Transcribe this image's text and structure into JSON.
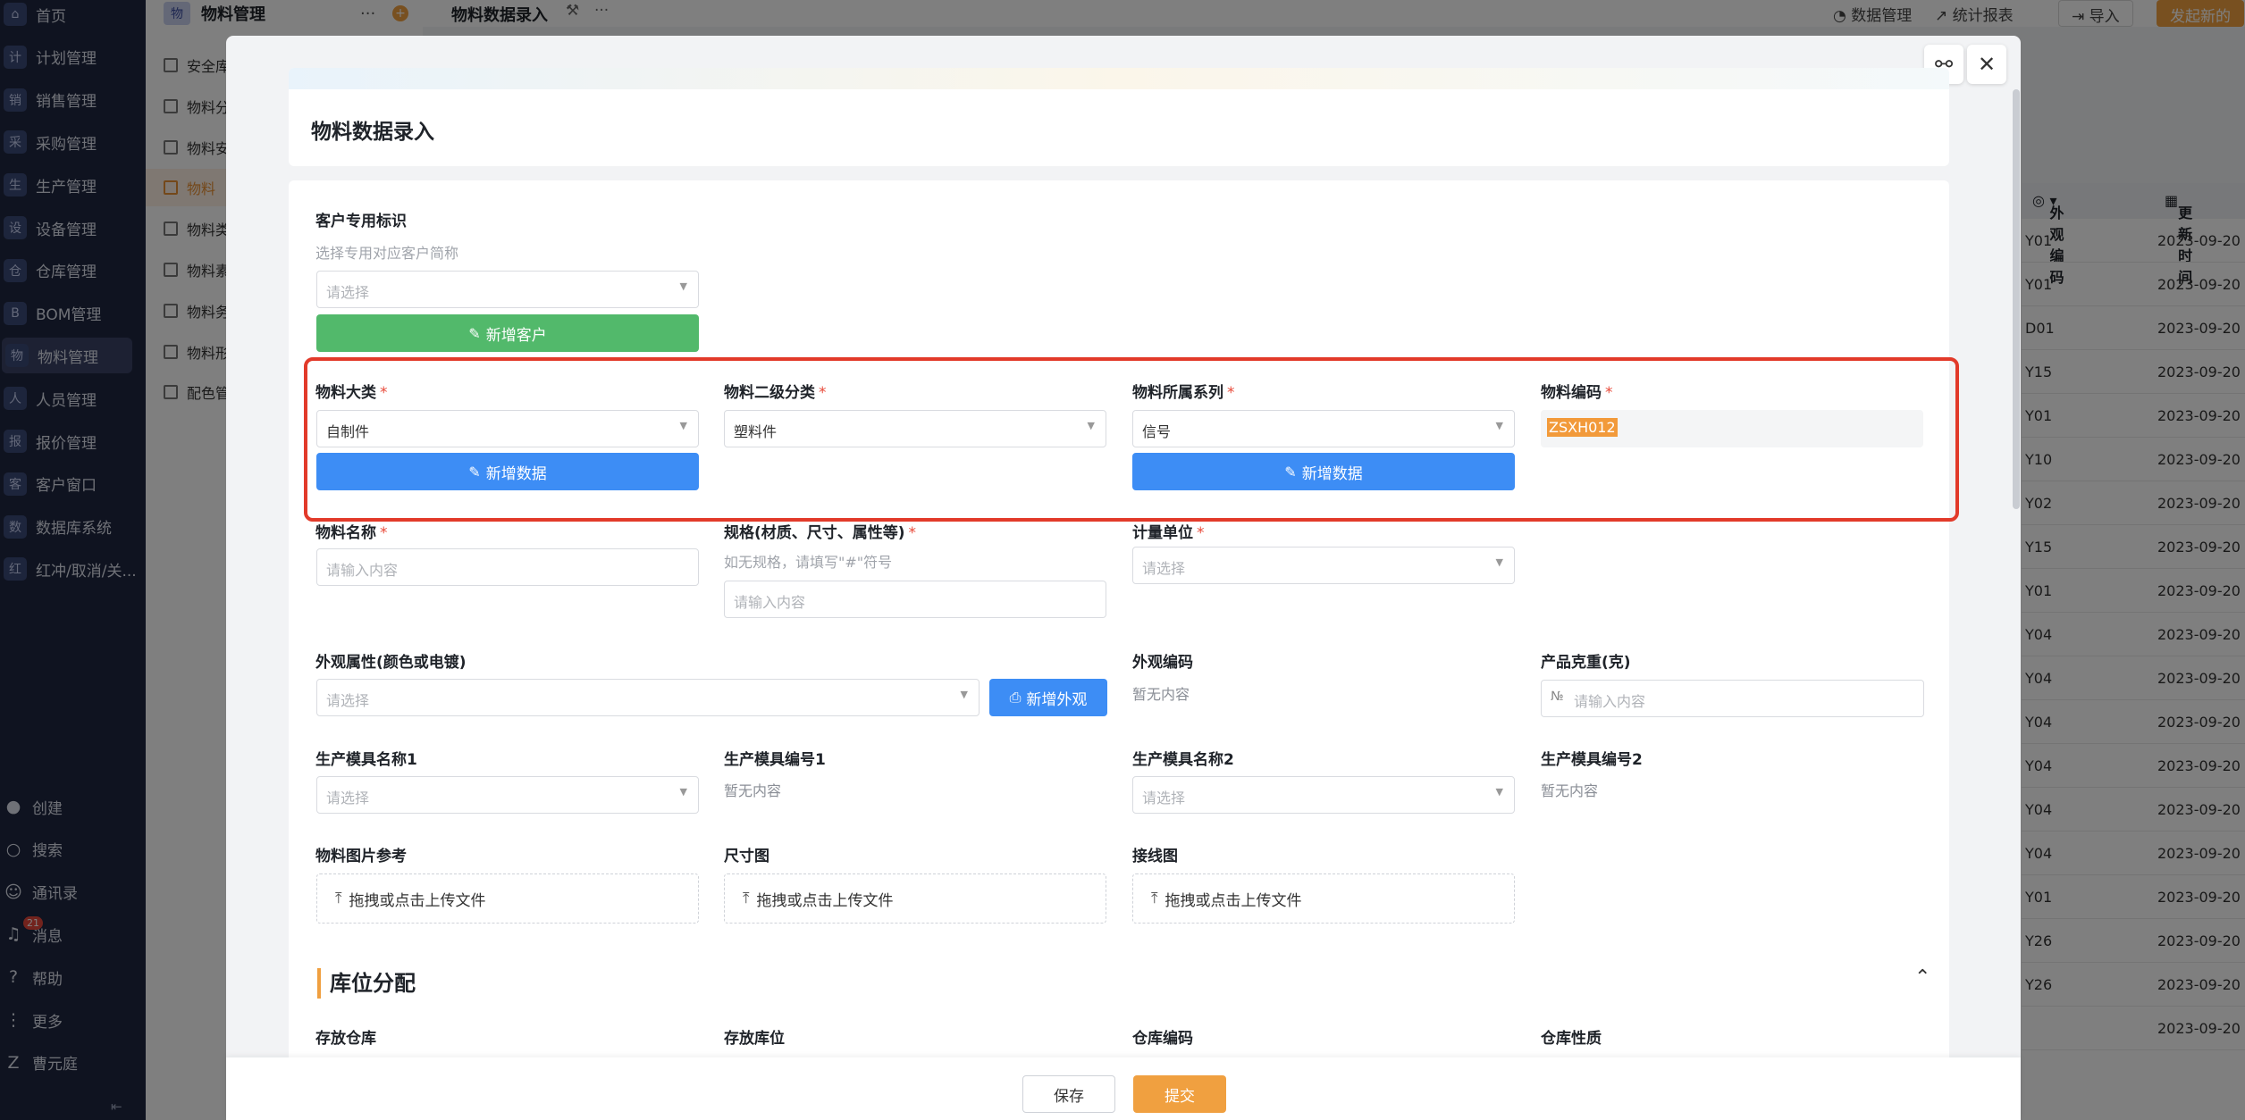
{
  "nav": {
    "items": [
      {
        "glyph": "⌂",
        "label": "首页"
      },
      {
        "glyph": "计",
        "label": "计划管理"
      },
      {
        "glyph": "销",
        "label": "销售管理"
      },
      {
        "glyph": "采",
        "label": "采购管理"
      },
      {
        "glyph": "生",
        "label": "生产管理"
      },
      {
        "glyph": "设",
        "label": "设备管理"
      },
      {
        "glyph": "仓",
        "label": "仓库管理"
      },
      {
        "glyph": "B",
        "label": "BOM管理"
      },
      {
        "glyph": "物",
        "label": "物料管理"
      },
      {
        "glyph": "人",
        "label": "人员管理"
      },
      {
        "glyph": "报",
        "label": "报价管理"
      },
      {
        "glyph": "客",
        "label": "客户窗口"
      },
      {
        "glyph": "数",
        "label": "数据库系统"
      },
      {
        "glyph": "红",
        "label": "红冲/取消/关..."
      }
    ],
    "bottom": [
      {
        "glyph": "●",
        "label": "创建"
      },
      {
        "glyph": "○",
        "label": "搜索"
      },
      {
        "glyph": "☺",
        "label": "通讯录"
      },
      {
        "glyph": "♫",
        "label": "消息"
      },
      {
        "glyph": "?",
        "label": "帮助"
      },
      {
        "glyph": "⋮",
        "label": "更多"
      },
      {
        "glyph": "Z",
        "label": "曹元庭"
      }
    ],
    "badge": "21"
  },
  "sub": {
    "glyph": "物",
    "title": "物料管理",
    "items": [
      "安全库",
      "物料分",
      "物料安",
      "物料",
      "物料类",
      "物料素",
      "物料务",
      "物料形",
      "配色管"
    ]
  },
  "topbar": {
    "title": "物料数据录入",
    "links": [
      "数据管理",
      "统计报表"
    ],
    "import": "导入",
    "primary": "发起新的"
  },
  "bgtable": {
    "col1": "外观编码",
    "col2": "更新时间",
    "rows": [
      [
        "Y01",
        "2023-09-20"
      ],
      [
        "Y01",
        "2023-09-20"
      ],
      [
        "D01",
        "2023-09-20"
      ],
      [
        "Y15",
        "2023-09-20"
      ],
      [
        "Y01",
        "2023-09-20"
      ],
      [
        "Y10",
        "2023-09-20"
      ],
      [
        "Y02",
        "2023-09-20"
      ],
      [
        "Y15",
        "2023-09-20"
      ],
      [
        "Y01",
        "2023-09-20"
      ],
      [
        "Y04",
        "2023-09-20"
      ],
      [
        "Y04",
        "2023-09-20"
      ],
      [
        "Y04",
        "2023-09-20"
      ],
      [
        "Y04",
        "2023-09-20"
      ],
      [
        "Y04",
        "2023-09-20"
      ],
      [
        "Y04",
        "2023-09-20"
      ],
      [
        "Y01",
        "2023-09-20"
      ],
      [
        "Y26",
        "2023-09-20"
      ],
      [
        "Y26",
        "2023-09-20"
      ],
      [
        "",
        "2023-09-20"
      ]
    ]
  },
  "modal": {
    "title": "物料数据录入",
    "customer": {
      "label": "客户专用标识",
      "hint": "选择专用对应客户简称",
      "placeholder": "请选择",
      "add_button": "新增客户"
    },
    "category": {
      "label": "物料大类",
      "value": "自制件",
      "add_button": "新增数据"
    },
    "sub_category": {
      "label": "物料二级分类",
      "value": "塑料件"
    },
    "series": {
      "label": "物料所属系列",
      "value": "信号",
      "add_button": "新增数据"
    },
    "code": {
      "label": "物料编码",
      "value": "ZSXH012"
    },
    "name": {
      "label": "物料名称",
      "placeholder": "请输入内容"
    },
    "spec": {
      "label": "规格(材质、尺寸、属性等)",
      "hint": "如无规格，请填写\"#\"符号",
      "placeholder": "请输入内容"
    },
    "unit": {
      "label": "计量单位",
      "placeholder": "请选择"
    },
    "appearance": {
      "label": "外观属性(颜色或电镀)",
      "placeholder": "请选择",
      "add_button": "新增外观"
    },
    "appearance_code": {
      "label": "外观编码",
      "empty": "暂无内容"
    },
    "weight": {
      "label": "产品克重(克)",
      "placeholder": "请输入内容"
    },
    "mold_name1": {
      "label": "生产模具名称1",
      "placeholder": "请选择"
    },
    "mold_no1": {
      "label": "生产模具编号1",
      "empty": "暂无内容"
    },
    "mold_name2": {
      "label": "生产模具名称2",
      "placeholder": "请选择"
    },
    "mold_no2": {
      "label": "生产模具编号2",
      "empty": "暂无内容"
    },
    "upload_hint": "拖拽或点击上传文件",
    "image_ref": {
      "label": "物料图片参考"
    },
    "dimension": {
      "label": "尺寸图"
    },
    "wiring": {
      "label": "接线图"
    },
    "section": "库位分配",
    "warehouse": {
      "label": "存放仓库"
    },
    "location": {
      "label": "存放库位"
    },
    "warehouse_code": {
      "label": "仓库编码"
    },
    "warehouse_type": {
      "label": "仓库性质"
    },
    "required_mark": "*"
  },
  "footer": {
    "save": "保存",
    "submit": "提交"
  },
  "colors": {
    "accent": "#f0a040",
    "blue": "#3d8df5",
    "green": "#52b96b",
    "highlight": "#e23a2a"
  }
}
